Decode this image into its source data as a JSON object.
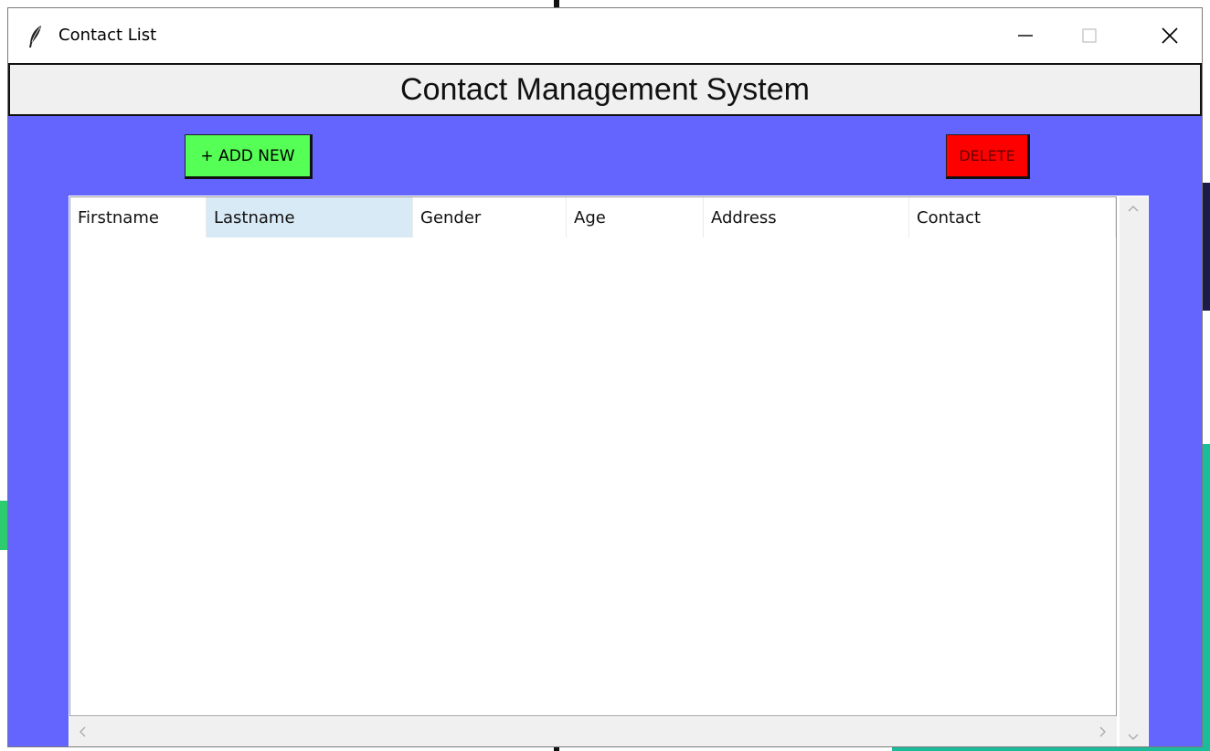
{
  "window": {
    "title": "Contact List",
    "controls": {
      "minimize_icon": "minimize-icon",
      "maximize_icon": "maximize-icon",
      "close_icon": "close-icon"
    }
  },
  "header": {
    "title": "Contact Management System"
  },
  "toolbar": {
    "add_label": "+ ADD NEW",
    "delete_label": "DELETE"
  },
  "table": {
    "columns": [
      "Firstname",
      "Lastname",
      "Gender",
      "Age",
      "Address",
      "Contact"
    ],
    "highlighted_column": "Lastname",
    "rows": []
  },
  "colors": {
    "background": "#6464ff",
    "add_button": "#55ff55",
    "delete_button": "#ff0000",
    "header_hover": "#d9eaf7"
  }
}
